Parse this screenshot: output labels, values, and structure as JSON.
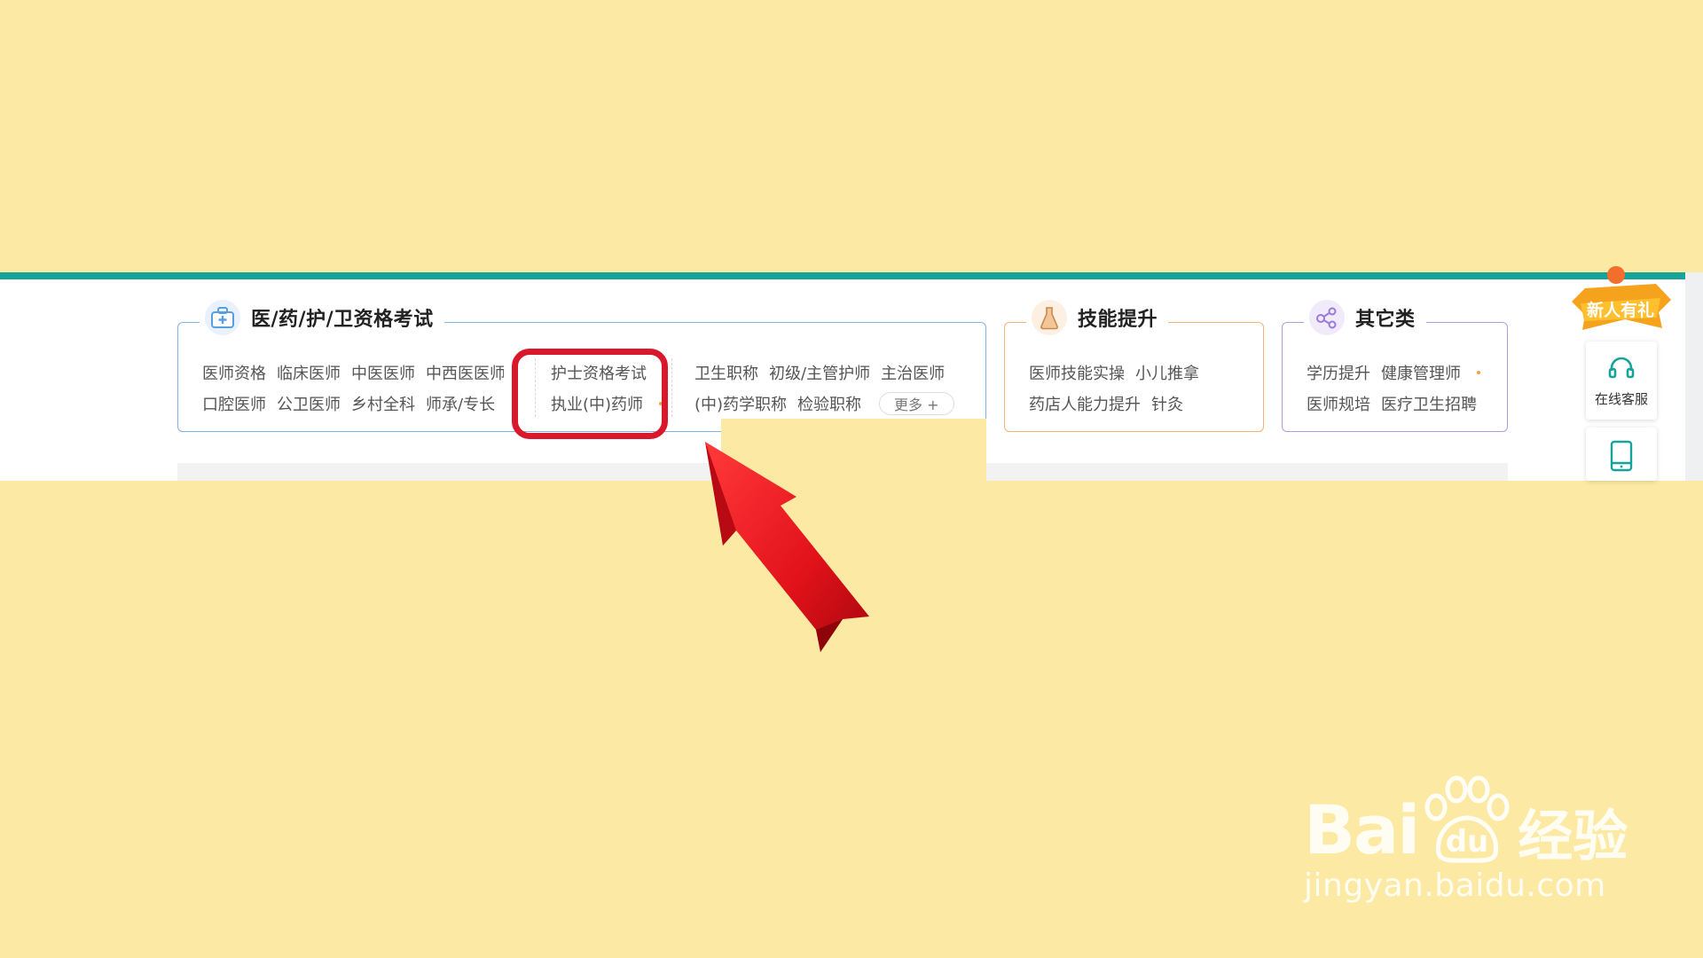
{
  "panels": {
    "medical": {
      "title": "医/药/护/卫资格考试",
      "col1_row1": [
        "医师资格",
        "临床医师",
        "中医医师",
        "中西医医师"
      ],
      "col1_row2": [
        "口腔医师",
        "公卫医师",
        "乡村全科",
        "师承/专长"
      ],
      "col2_row1": [
        "护士资格考试"
      ],
      "col2_row2": [
        "执业(中)药师"
      ],
      "col3_row1": [
        "卫生职称",
        "初级/主管护师",
        "主治医师"
      ],
      "col3_row2": [
        "(中)药学职称",
        "检验职称"
      ],
      "more_label": "更多 +",
      "color": "#7fb2e5"
    },
    "skills": {
      "title": "技能提升",
      "row1": [
        "医师技能实操",
        "小儿推拿"
      ],
      "row2": [
        "药店人能力提升",
        "针灸"
      ],
      "color": "#f2b27a"
    },
    "other": {
      "title": "其它类",
      "row1": [
        "学历提升",
        "健康管理师"
      ],
      "row2": [
        "医师规培",
        "医疗卫生招聘"
      ],
      "color": "#b49be0"
    }
  },
  "side": {
    "badge_label": "新人有礼",
    "service_label": "在线客服",
    "headset_icon": "headset-icon",
    "tablet_icon": "tablet-icon"
  },
  "watermark": {
    "brand": "Bai",
    "brand_suffix": "经验",
    "url": "jingyan.baidu.com"
  },
  "annotation": {
    "highlight_color": "#d9192b",
    "arrow_color": "#e3121b"
  }
}
